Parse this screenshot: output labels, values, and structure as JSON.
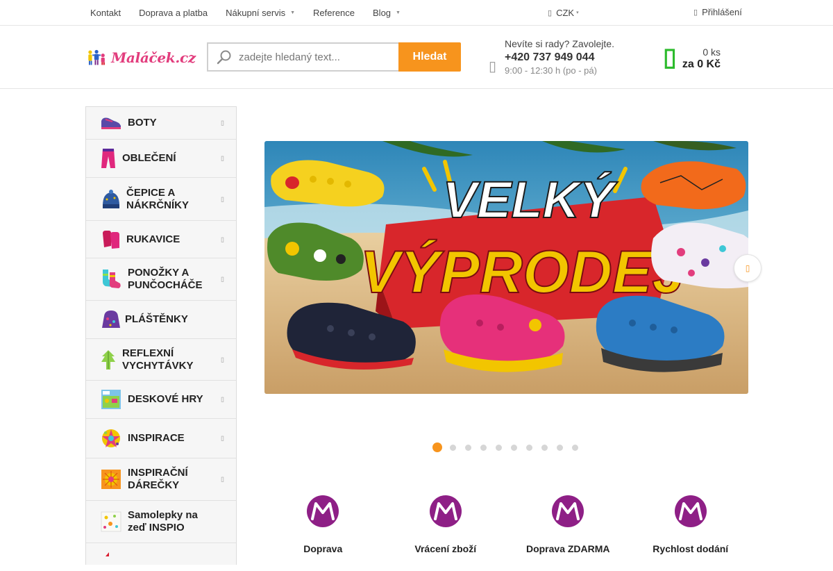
{
  "topnav": {
    "items": [
      {
        "label": "Kontakt",
        "dropdown": false
      },
      {
        "label": "Doprava a platba",
        "dropdown": false
      },
      {
        "label": "Nákupní servis",
        "dropdown": true
      },
      {
        "label": "Reference",
        "dropdown": false
      },
      {
        "label": "Blog",
        "dropdown": true
      }
    ],
    "currency": "CZK",
    "login": "Přihlášení"
  },
  "header": {
    "logo_text": "Maláček.cz",
    "search_placeholder": "zadejte hledaný text...",
    "search_button": "Hledat",
    "contact_question": "Nevíte si rady? Zavolejte.",
    "contact_phone": "+420 737 949 044",
    "contact_hours": "9:00 - 12:30 h (po - pá)",
    "cart_count": "0 ks",
    "cart_total": "za 0 Kč"
  },
  "categories": [
    {
      "label": "BOTY",
      "has_submenu": true,
      "icon": "shoe-icon"
    },
    {
      "label": "OBLEČENÍ",
      "has_submenu": true,
      "icon": "pants-icon"
    },
    {
      "label": "ČEPICE A NÁKRČNÍKY",
      "has_submenu": true,
      "icon": "hat-icon"
    },
    {
      "label": "RUKAVICE",
      "has_submenu": true,
      "icon": "gloves-icon"
    },
    {
      "label": "PONOŽKY A PUNČOCHÁČE",
      "has_submenu": true,
      "icon": "socks-icon"
    },
    {
      "label": "PLÁŠTĚNKY",
      "has_submenu": false,
      "icon": "raincoat-icon"
    },
    {
      "label": "REFLEXNÍ VYCHYTÁVKY",
      "has_submenu": true,
      "icon": "reflective-icon"
    },
    {
      "label": "DESKOVÉ HRY",
      "has_submenu": true,
      "icon": "board-game-icon"
    },
    {
      "label": "INSPIRACE",
      "has_submenu": true,
      "icon": "inspiration-icon"
    },
    {
      "label": "INSPIRAČNÍ DÁREČKY",
      "has_submenu": true,
      "icon": "gift-icon"
    },
    {
      "label": "Samolepky na zeď INSPIO",
      "has_submenu": false,
      "icon": "sticker-icon"
    }
  ],
  "banner": {
    "line1": "VELKÝ",
    "line2": "VÝPRODEJ",
    "slide_count": 10,
    "active_slide": 1
  },
  "benefits": [
    {
      "title": "Doprava"
    },
    {
      "title": "Vrácení zboží"
    },
    {
      "title": "Doprava ZDARMA"
    },
    {
      "title": "Rychlost dodání"
    }
  ],
  "colors": {
    "accent": "#f7941d",
    "cart": "#2dbb2d",
    "brand": "#8e1f86"
  }
}
